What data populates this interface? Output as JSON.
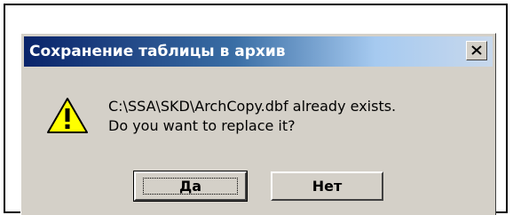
{
  "dialog": {
    "title": "Сохранение таблицы в архив",
    "message_line1": "C:\\SSA\\SKD\\ArchCopy.dbf already exists.",
    "message_line2": "Do you want to replace it?",
    "icon": "warning-icon",
    "buttons": {
      "yes": "Да",
      "no": "Нет"
    },
    "close_icon": "close-icon"
  }
}
